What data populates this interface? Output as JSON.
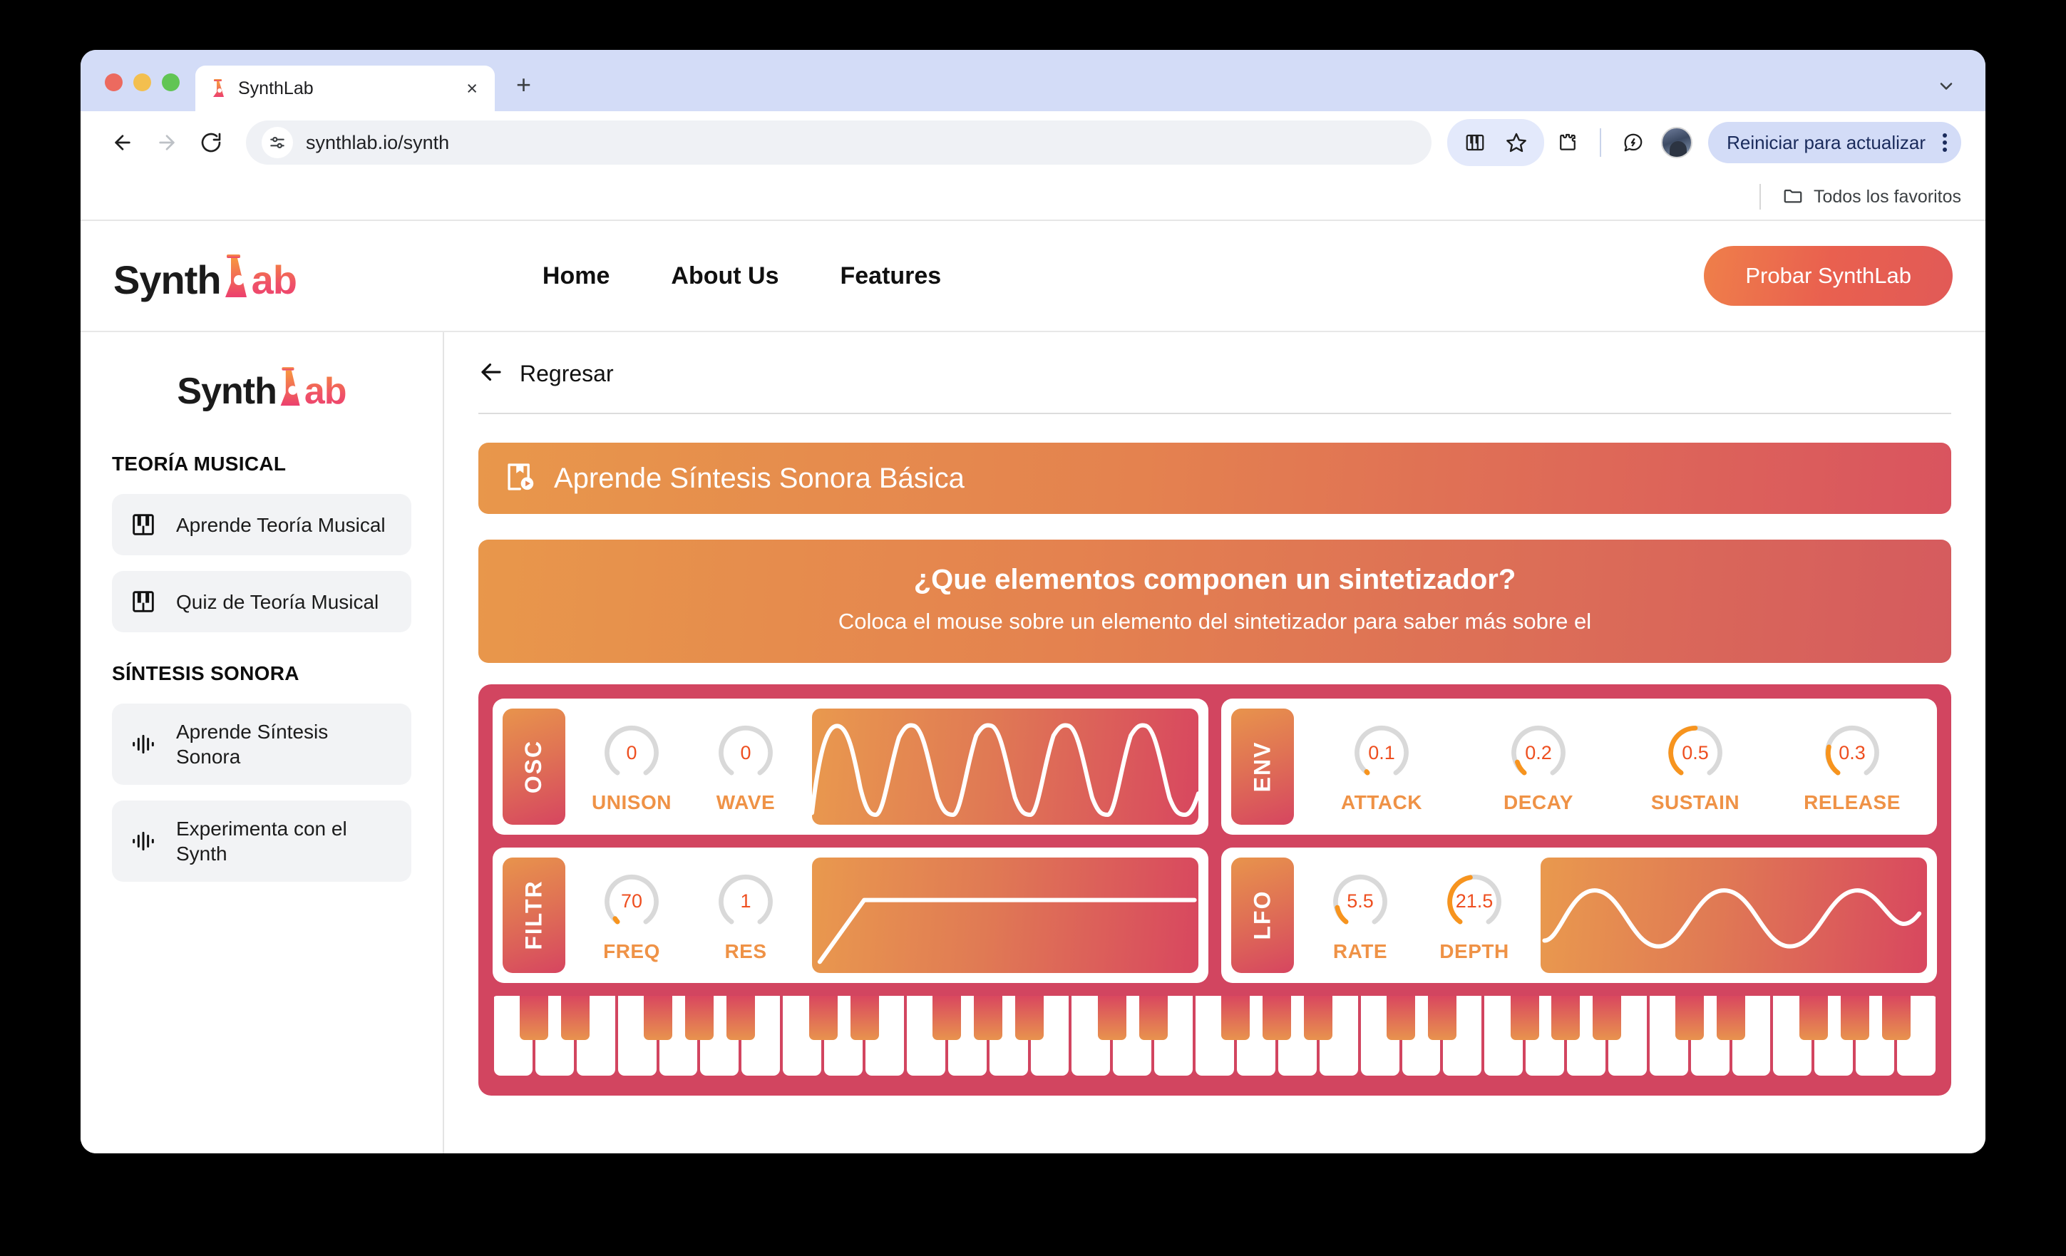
{
  "browser": {
    "tab": {
      "title": "SynthLab",
      "favicon": "synthlab-flask-icon",
      "close": "×"
    },
    "new_tab_label": "+",
    "url": "synthlab.io/synth",
    "toolbar_icons": [
      "piano-icon",
      "star-icon",
      "extensions-icon",
      "performance-icon"
    ],
    "update_button_label": "Reiniciar para actualizar",
    "bookmarks": {
      "folder_label": "Todos los favoritos"
    }
  },
  "site": {
    "logo": {
      "prefix": "Synth",
      "suffix": "ab"
    },
    "nav": [
      {
        "label": "Home"
      },
      {
        "label": "About Us"
      },
      {
        "label": "Features"
      }
    ],
    "cta_label": "Probar SynthLab"
  },
  "sidebar": {
    "logo": {
      "prefix": "Synth",
      "suffix": "ab"
    },
    "sections": [
      {
        "heading": "TEORÍA MUSICAL",
        "items": [
          {
            "label": "Aprende Teoría Musical",
            "icon": "piano-keys-icon"
          },
          {
            "label": "Quiz de Teoría Musical",
            "icon": "piano-keys-icon"
          }
        ]
      },
      {
        "heading": "SÍNTESIS SONORA",
        "items": [
          {
            "label": "Aprende Síntesis Sonora",
            "icon": "waveform-icon"
          },
          {
            "label": "Experimenta con el Synth",
            "icon": "waveform-icon"
          }
        ]
      }
    ]
  },
  "main": {
    "back_label": "Regresar",
    "title": "Aprende Síntesis Sonora Básica",
    "title_icon": "book-play-icon",
    "question": "¿Que elementos componen un sintetizador?",
    "question_sub": "Coloca el mouse sobre un elemento del sintetizador para saber más sobre el"
  },
  "synth": {
    "modules": [
      {
        "tag": "OSC",
        "knobs": [
          {
            "name": "UNISON",
            "value": "0",
            "fill": 0
          },
          {
            "name": "WAVE",
            "value": "0",
            "fill": 0
          }
        ],
        "display": "sine-wave-4-cycles"
      },
      {
        "tag": "ENV",
        "knobs": [
          {
            "name": "ATTACK",
            "value": "0.1",
            "fill": 0.02
          },
          {
            "name": "DECAY",
            "value": "0.2",
            "fill": 0.13
          },
          {
            "name": "SUSTAIN",
            "value": "0.5",
            "fill": 0.5
          },
          {
            "name": "RELEASE",
            "value": "0.3",
            "fill": 0.33
          }
        ],
        "display": null
      },
      {
        "tag": "FILTR",
        "knobs": [
          {
            "name": "FREQ",
            "value": "70",
            "fill": 0.04
          },
          {
            "name": "RES",
            "value": "1",
            "fill": 0
          }
        ],
        "display": "ramp-hold-curve"
      },
      {
        "tag": "LFO",
        "knobs": [
          {
            "name": "RATE",
            "value": "5.5",
            "fill": 0.1
          },
          {
            "name": "DEPTH",
            "value": "21.5",
            "fill": 0.45
          }
        ],
        "display": "slow-sine-2-cycles"
      }
    ],
    "keyboard": {
      "octaves": 5,
      "white_keys_per_octave": 7,
      "black_key_positions": [
        0,
        1,
        3,
        4,
        5
      ]
    }
  },
  "colors": {
    "accent_orange": "#ef9246",
    "accent_value": "#ee4f20",
    "brand_crimson": "#d24560",
    "gradient_start": "#e8974b",
    "gradient_end": "#d8475f"
  }
}
